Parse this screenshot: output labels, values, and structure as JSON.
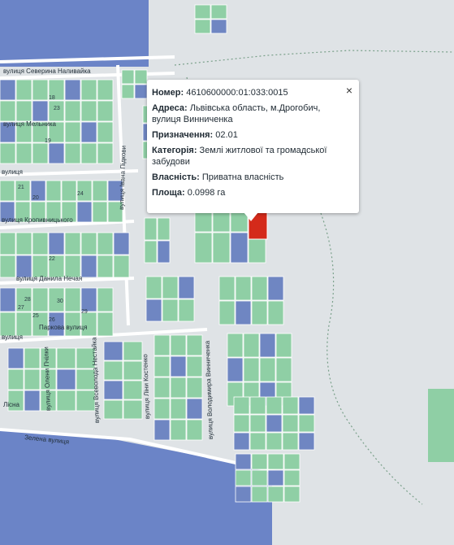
{
  "map": {
    "streets": [
      "вулиця Северина Наливайка",
      "вулиця Мельника",
      "вулиця",
      "вулиця Кропивницького",
      "вулиця Данила Нечая",
      "вулиця",
      "Паркова вулиця",
      "вулиця Івана Підкови",
      "вулиця Олени Пчілки",
      "вулиця Всеволода Нестайка",
      "вулиця Ліни Костенко",
      "вулиця Володимира Винниченка",
      "Лісна",
      "Зелена вулиця"
    ],
    "house_numbers": [
      "18",
      "23",
      "19",
      "21",
      "20",
      "24",
      "22",
      "28",
      "25",
      "26",
      "30",
      "29",
      "27"
    ],
    "colors": {
      "parcel_green": "#8fcfa5",
      "parcel_blue": "#6f86c2",
      "selected_parcel": "#d42a1a",
      "region_blue": "#6b84c7",
      "background": "#dfe3e6"
    }
  },
  "popup": {
    "number_label": "Номер:",
    "number_value": "4610600000:01:033:0015",
    "address_label": "Адреса:",
    "address_value": "Львівська область, м.Дрогобич, вулиця Винниченка",
    "purpose_label": "Призначення:",
    "purpose_value": "02.01",
    "category_label": "Категорія:",
    "category_value": "Землі житлової та громадської забудови",
    "ownership_label": "Власність:",
    "ownership_value": "Приватна власність",
    "area_label": "Площа:",
    "area_value": "0.0998 га",
    "close_icon": "×"
  }
}
